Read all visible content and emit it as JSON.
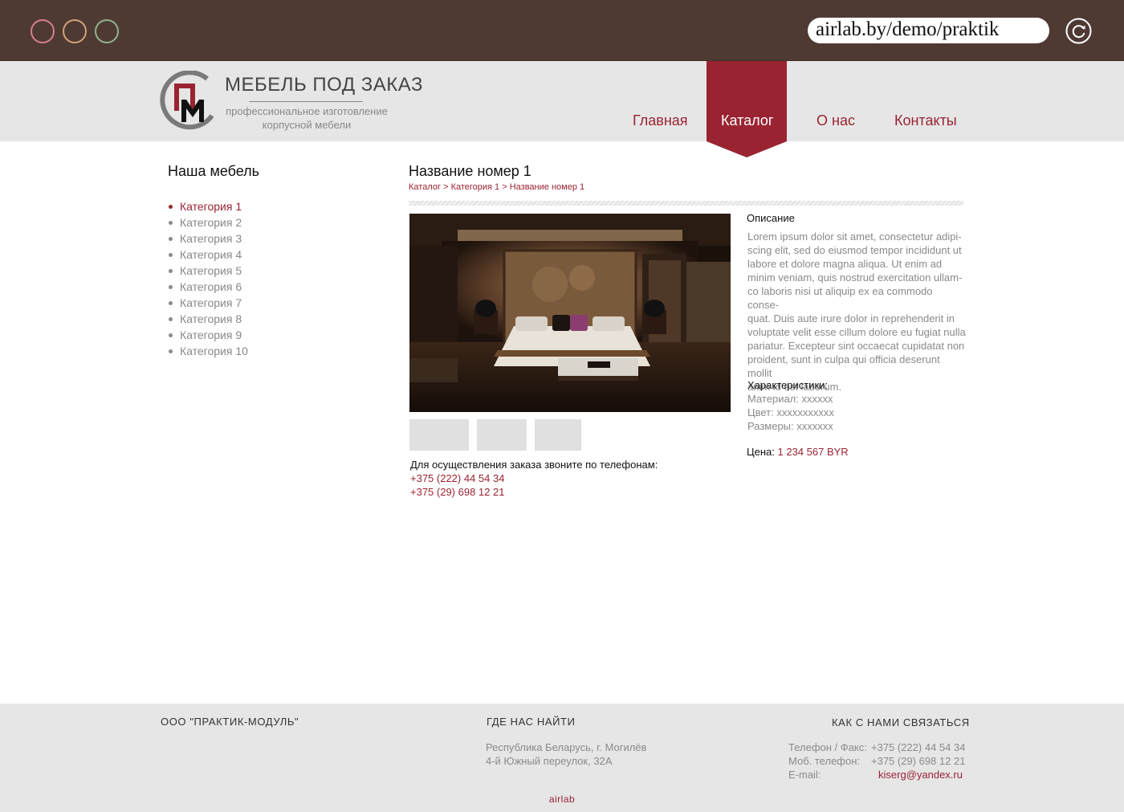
{
  "browser": {
    "url": "airlab.by/demo/praktik",
    "controls": [
      "close",
      "minimize",
      "maximize"
    ]
  },
  "brand": {
    "logo_letters": "ПМ",
    "title": "МЕБЕЛЬ ПОД ЗАКАЗ",
    "subtitle_line1": "профессиональное изготовление",
    "subtitle_line2": "корпусной мебели"
  },
  "nav": {
    "items": [
      {
        "label": "Главная",
        "active": false
      },
      {
        "label": "Каталог",
        "active": true
      },
      {
        "label": "О нас",
        "active": false
      },
      {
        "label": "Контакты",
        "active": false
      }
    ]
  },
  "sidebar": {
    "title": "Наша мебель",
    "categories": [
      {
        "label": "Категория 1",
        "active": true
      },
      {
        "label": "Категория 2"
      },
      {
        "label": "Категория 3"
      },
      {
        "label": "Категория 4"
      },
      {
        "label": "Категория 5"
      },
      {
        "label": "Категория 6"
      },
      {
        "label": "Категория 7"
      },
      {
        "label": "Категория 8"
      },
      {
        "label": "Категория 9"
      },
      {
        "label": "Категория 10"
      }
    ]
  },
  "product": {
    "title": "Название номер 1",
    "breadcrumb": [
      "Каталог",
      "Категория 1",
      "Название номер 1"
    ],
    "breadcrumb_separator": ">",
    "order_text": "Для осуществления заказа звоните по телефонам:",
    "phones": [
      "+375 (222) 44 54 34",
      "+375 (29) 698 12 21"
    ],
    "description_heading": "Описание",
    "description_lines": [
      "Lorem ipsum dolor sit amet, consectetur adipi-",
      "scing elit, sed do eiusmod tempor incididunt ut",
      "labore et dolore magna aliqua. Ut enim ad",
      "minim veniam, quis nostrud exercitation ullam-",
      "co laboris nisi ut aliquip ex ea commodo conse-",
      "quat. Duis aute irure dolor in reprehenderit in",
      "voluptate velit esse cillum dolore eu fugiat nulla",
      "pariatur. Excepteur sint occaecat cupidatat non",
      "proident, sunt in culpa qui officia deserunt mollit",
      "anim id est laborum."
    ],
    "specs_heading": "Характеристики:",
    "specs": [
      "Материал: xxxxxx",
      "Цвет: xxxxxxxxxxx",
      "Размеры: xxxxxxx"
    ],
    "price_label": "Цена:",
    "price_value": "1 234 567 BYR"
  },
  "footer": {
    "company": "ООО \"ПРАКТИК-МОДУЛЬ\"",
    "find_heading": "ГДЕ НАС НАЙТИ",
    "address_line1": "Республика Беларусь, г. Могилёв",
    "address_line2": "4-й Южный переулок, 32А",
    "contact_heading": "КАК С НАМИ СВЯЗАТЬСЯ",
    "phone_fax_label": "Телефон / Факс:",
    "phone_fax_value": "+375 (222) 44 54 34",
    "mobile_label": "Моб. телефон:",
    "mobile_value": "+375 (29) 698 12 21",
    "email_label": "E-mail:",
    "email_value": "kiserg@yandex.ru",
    "credit": "airlab"
  },
  "colors": {
    "accent": "#9a2332",
    "chrome": "#4f3a33",
    "header_bg": "#e6e6e6",
    "muted_text": "#8a8a8a"
  }
}
